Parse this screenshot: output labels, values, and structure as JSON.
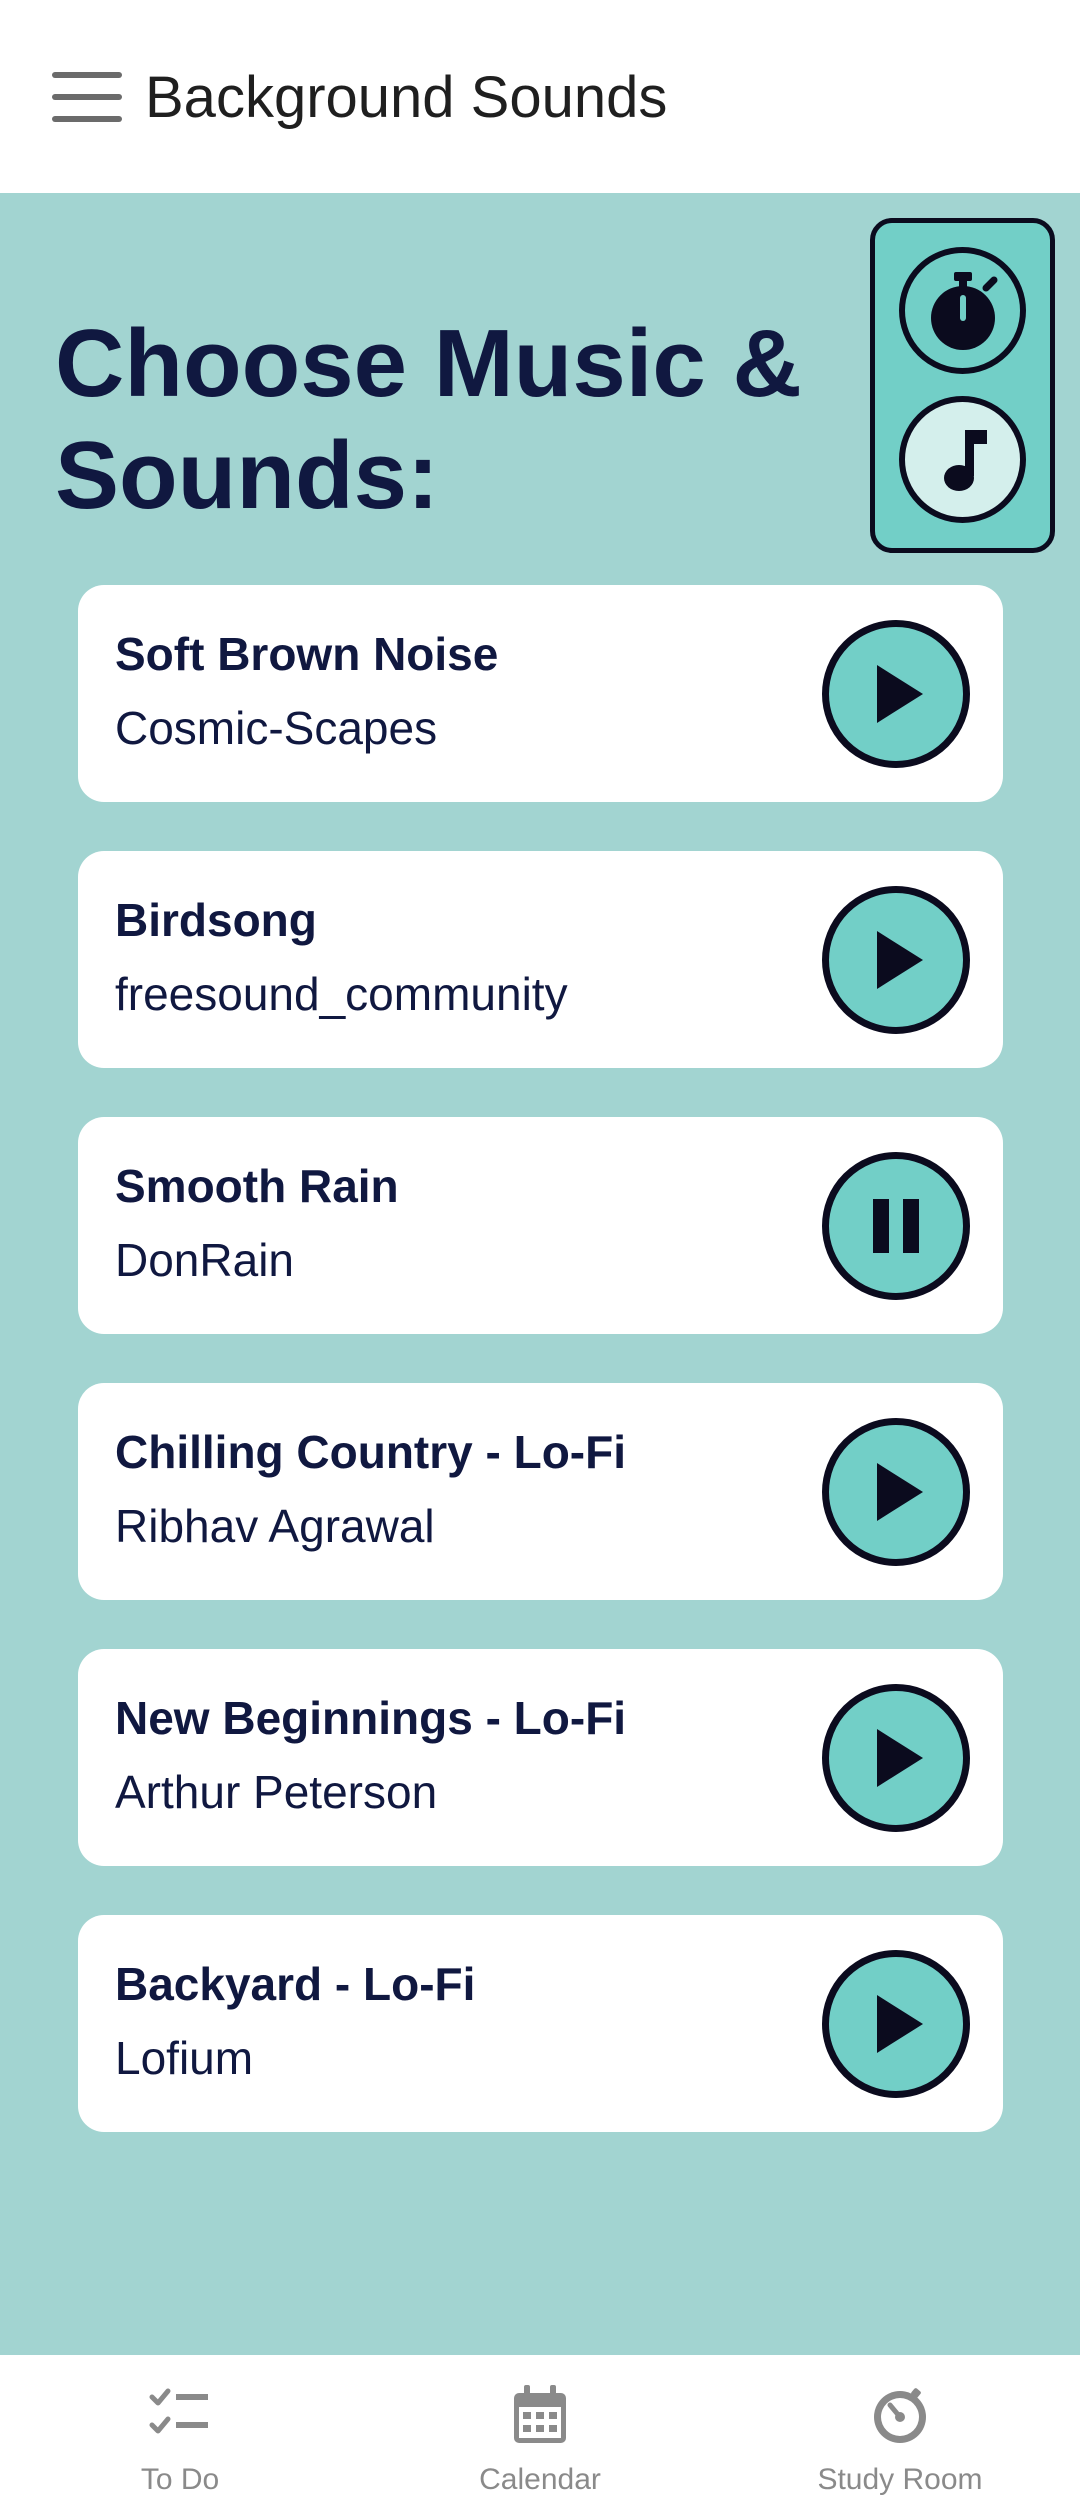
{
  "app_bar": {
    "title": "Background Sounds"
  },
  "heading": "Choose Music & Sounds:",
  "tracks": [
    {
      "title": "Soft Brown Noise",
      "artist": "Cosmic-Scapes",
      "state": "play"
    },
    {
      "title": "Birdsong",
      "artist": "freesound_community",
      "state": "play"
    },
    {
      "title": "Smooth Rain",
      "artist": "DonRain",
      "state": "pause"
    },
    {
      "title": "Chilling Country - Lo-Fi",
      "artist": "Ribhav Agrawal",
      "state": "play"
    },
    {
      "title": "New Beginnings - Lo-Fi",
      "artist": "Arthur Peterson",
      "state": "play"
    },
    {
      "title": "Backyard - Lo-Fi",
      "artist": "Lofium",
      "state": "play"
    }
  ],
  "bottom_nav": {
    "items": [
      {
        "label": "To Do",
        "icon": "checklist-icon"
      },
      {
        "label": "Calendar",
        "icon": "calendar-icon"
      },
      {
        "label": "Study Room",
        "icon": "timer-dial-icon"
      }
    ]
  },
  "colors": {
    "background": "#a2d4d1",
    "accent": "#72cfc7",
    "text_dark": "#101840",
    "nav_grey": "#8a8a8a"
  }
}
